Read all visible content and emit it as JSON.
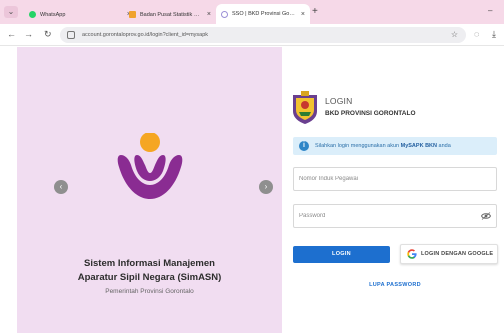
{
  "browser": {
    "tabs": [
      {
        "title": "WhatsApp",
        "close": "×"
      },
      {
        "title": "Badan Pusat Statistik Provinsi Gorontalo",
        "close": "×"
      },
      {
        "title": "SSO | BKD Provinsi Gorontalo",
        "close": "×"
      }
    ],
    "new_tab": "+",
    "url": "account.gorontaloprov.go.id/login?client_id=mysapk",
    "window_control": "–"
  },
  "hero": {
    "title_line1": "Sistem Informasi Manajemen",
    "title_line2": "Aparatur Sipil Negara (SimASN)",
    "subtitle": "Pemerintah Provinsi Gorontalo",
    "prev_arrow": "‹",
    "next_arrow": "›"
  },
  "login": {
    "heading": "LOGIN",
    "organization": "BKD PROVINSI GORONTALO",
    "alert_prefix": "Silahkan login menggunakan akun ",
    "alert_bold": "MySAPK BKN",
    "alert_suffix": " anda",
    "nip_placeholder": "Nomor Induk Pegawai",
    "password_placeholder": "Password",
    "login_button": "LOGIN",
    "google_button": "LOGIN DENGAN GOOGLE",
    "forgot_link": "LUPA PASSWORD"
  },
  "colors": {
    "tab_strip": "#f6d9e8",
    "hero_bg": "#f1ddf1",
    "logo_purple": "#8a2c92",
    "logo_orange": "#f5a623",
    "primary_blue": "#1d6fcf",
    "alert_bg": "#dbeefa"
  },
  "icons": [
    "whatsapp-icon",
    "bps-icon",
    "sso-icon",
    "back-icon",
    "forward-icon",
    "reload-icon",
    "site-info-icon",
    "star-icon",
    "extension-icon",
    "download-icon",
    "info-icon",
    "eye-icon",
    "google-icon"
  ]
}
